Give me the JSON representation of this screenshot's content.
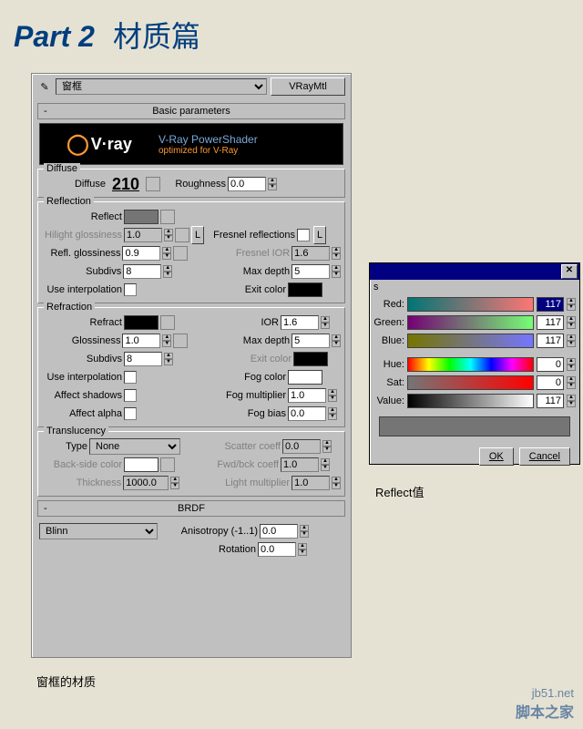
{
  "title": {
    "part": "Part 2",
    "chinese": "材质篇"
  },
  "top": {
    "material_name": "窗框",
    "type_btn": "VRayMtl"
  },
  "rollouts": {
    "basic": "Basic parameters",
    "brdf": "BRDF"
  },
  "banner": {
    "logo": "V·ray",
    "line1": "V-Ray PowerShader",
    "line2": "optimized for V-Ray"
  },
  "diffuse": {
    "title": "Diffuse",
    "diffuse_lbl": "Diffuse",
    "diffuse_val": "210",
    "roughness_lbl": "Roughness",
    "roughness_val": "0.0"
  },
  "reflection": {
    "title": "Reflection",
    "reflect_lbl": "Reflect",
    "hilight_lbl": "Hilight glossiness",
    "hilight_val": "1.0",
    "refl_gloss_lbl": "Refl. glossiness",
    "refl_gloss_val": "0.9",
    "subdivs_lbl": "Subdivs",
    "subdivs_val": "8",
    "use_interp_lbl": "Use interpolation",
    "l_btn": "L",
    "fresnel_lbl": "Fresnel reflections",
    "fresnel_ior_lbl": "Fresnel IOR",
    "fresnel_ior_val": "1.6",
    "max_depth_lbl": "Max depth",
    "max_depth_val": "5",
    "exit_color_lbl": "Exit color"
  },
  "refraction": {
    "title": "Refraction",
    "refract_lbl": "Refract",
    "glossiness_lbl": "Glossiness",
    "glossiness_val": "1.0",
    "subdivs_lbl": "Subdivs",
    "subdivs_val": "8",
    "use_interp_lbl": "Use interpolation",
    "affect_shadows_lbl": "Affect shadows",
    "affect_alpha_lbl": "Affect alpha",
    "ior_lbl": "IOR",
    "ior_val": "1.6",
    "max_depth_lbl": "Max depth",
    "max_depth_val": "5",
    "exit_color_lbl": "Exit color",
    "fog_color_lbl": "Fog color",
    "fog_mult_lbl": "Fog multiplier",
    "fog_mult_val": "1.0",
    "fog_bias_lbl": "Fog bias",
    "fog_bias_val": "0.0"
  },
  "translucency": {
    "title": "Translucency",
    "type_lbl": "Type",
    "type_val": "None",
    "back_side_lbl": "Back-side color",
    "thickness_lbl": "Thickness",
    "thickness_val": "1000.0",
    "scatter_lbl": "Scatter coeff",
    "scatter_val": "0.0",
    "fwdbck_lbl": "Fwd/bck coeff",
    "fwdbck_val": "1.0",
    "light_mult_lbl": "Light multiplier",
    "light_mult_val": "1.0"
  },
  "brdf": {
    "type": "Blinn",
    "aniso_lbl": "Anisotropy (-1..1)",
    "aniso_val": "0.0",
    "rotation_lbl": "Rotation",
    "rotation_val": "0.0"
  },
  "picker": {
    "s": "s",
    "red": "Red:",
    "green": "Green:",
    "blue": "Blue:",
    "hue": "Hue:",
    "sat": "Sat:",
    "value": "Value:",
    "vals": {
      "red": "117",
      "green": "117",
      "blue": "117",
      "hue": "0",
      "sat": "0",
      "value": "117"
    },
    "ok": "OK",
    "cancel": "Cancel"
  },
  "labels": {
    "reflect_val": "Reflect值",
    "caption": "窗框的材质"
  },
  "watermark": {
    "url": "jb51.net",
    "name": "脚本之家"
  }
}
